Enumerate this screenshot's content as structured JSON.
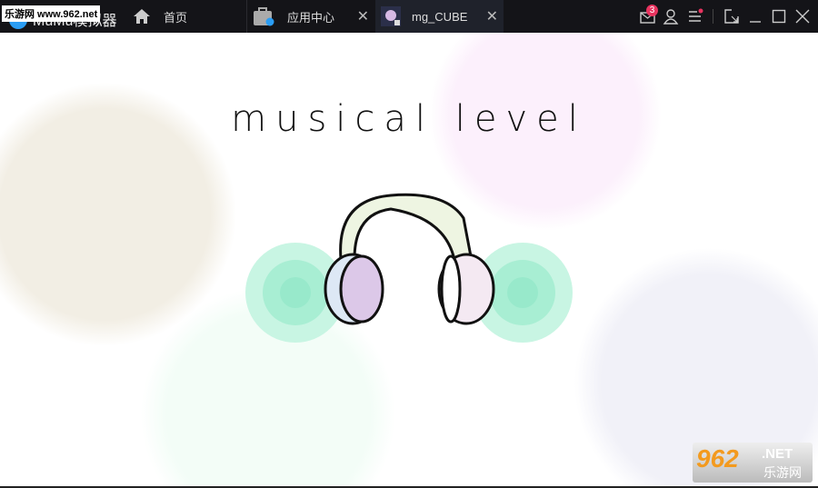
{
  "titlebar": {
    "watermark": "乐游网 www.962.net",
    "app_name": "MuMu模拟器",
    "badge_count": "3"
  },
  "tabs": [
    {
      "label": "首页"
    },
    {
      "label": "应用中心"
    },
    {
      "label": "mg_CUBE",
      "active": true
    }
  ],
  "game": {
    "title": "musical level"
  },
  "watermark": {
    "brand": "962",
    "suffix": ".NET",
    "cn": "乐游网"
  }
}
